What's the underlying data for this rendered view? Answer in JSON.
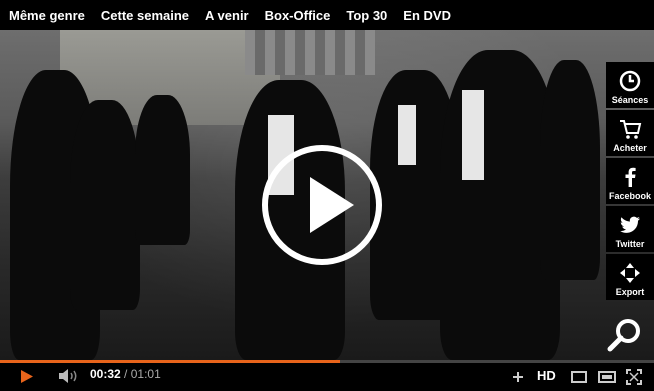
{
  "nav": {
    "items": [
      "Même genre",
      "Cette semaine",
      "A venir",
      "Box-Office",
      "Top 30",
      "En DVD"
    ]
  },
  "side_panel": {
    "buttons": [
      {
        "label": "Séances",
        "icon": "clock-icon"
      },
      {
        "label": "Acheter",
        "icon": "cart-icon"
      },
      {
        "label": "Facebook",
        "icon": "facebook-icon"
      },
      {
        "label": "Twitter",
        "icon": "twitter-icon"
      },
      {
        "label": "Export",
        "icon": "export-arrows-icon"
      }
    ]
  },
  "player": {
    "current_time": "00:32",
    "separator": "/",
    "total_time": "01:01",
    "progress": 0.52,
    "hd_label": "HD",
    "accent_color": "#e8641b"
  }
}
